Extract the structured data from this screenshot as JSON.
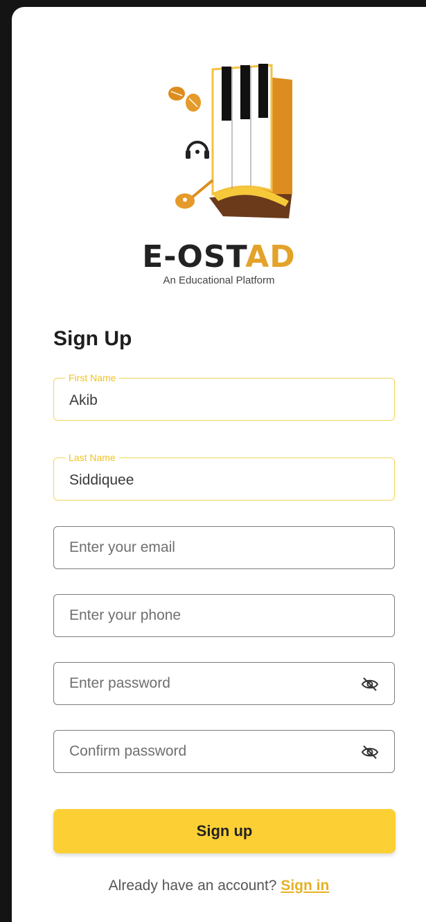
{
  "brand": {
    "name_prefix": "E-OST",
    "name_accent": "AD",
    "tagline": "An Educational Platform"
  },
  "form": {
    "title": "Sign Up",
    "first_name": {
      "label": "First Name",
      "value": "Akib"
    },
    "last_name": {
      "label": "Last Name",
      "value": "Siddiquee"
    },
    "email": {
      "placeholder": "Enter your email"
    },
    "phone": {
      "placeholder": "Enter your phone"
    },
    "password": {
      "placeholder": "Enter password"
    },
    "confirm_password": {
      "placeholder": "Confirm password"
    },
    "submit_label": "Sign up"
  },
  "footer": {
    "prompt": "Already have an account? ",
    "link": "Sign in"
  },
  "icons": {
    "toggle_visibility": "eye-off-icon"
  },
  "colors": {
    "accent": "#fcd035",
    "accent_text": "#f0c322",
    "brand_orange": "#e3a32a"
  }
}
